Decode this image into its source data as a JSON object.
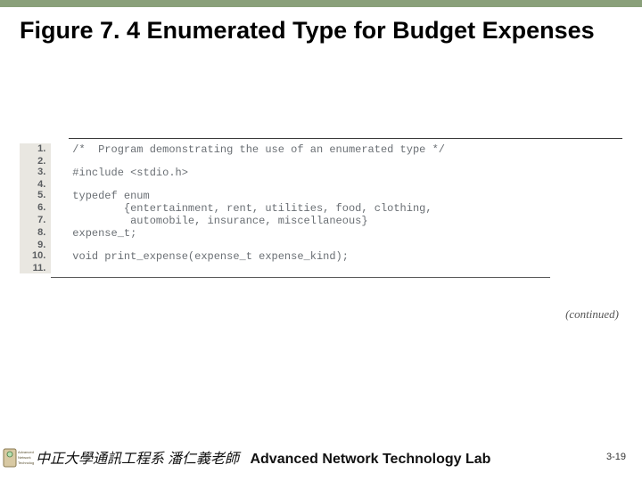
{
  "title": "Figure 7. 4  Enumerated Type for Budget Expenses",
  "code": {
    "lines": [
      {
        "n": "1.",
        "text": "/*  Program demonstrating the use of an enumerated type */"
      },
      {
        "n": "2.",
        "text": ""
      },
      {
        "n": "3.",
        "text": "#include <stdio.h>"
      },
      {
        "n": "4.",
        "text": ""
      },
      {
        "n": "5.",
        "text": "typedef enum"
      },
      {
        "n": "6.",
        "text": "        {entertainment, rent, utilities, food, clothing,"
      },
      {
        "n": "7.",
        "text": "         automobile, insurance, miscellaneous}"
      },
      {
        "n": "8.",
        "text": "expense_t;"
      },
      {
        "n": "9.",
        "text": ""
      },
      {
        "n": "10.",
        "text": "void print_expense(expense_t expense_kind);"
      },
      {
        "n": "11.",
        "text": ""
      }
    ]
  },
  "continued": "(continued)",
  "footer": {
    "cjk": "中正大學通訊工程系 潘仁義老師",
    "en": "Advanced Network Technology Lab",
    "page": "3-19"
  }
}
